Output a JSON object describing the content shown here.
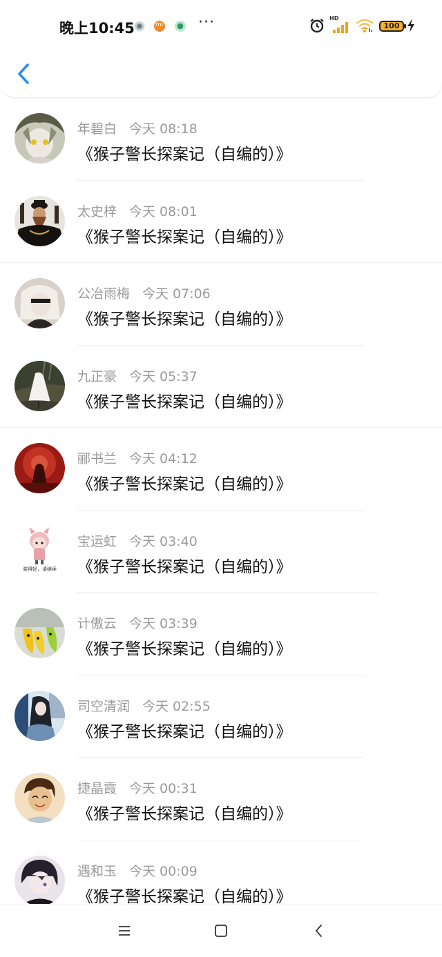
{
  "status_bar": {
    "time": "晚上10:45",
    "hd_label": "HD",
    "battery": "100",
    "icons": [
      "notification-icon",
      "mi-icon",
      "app-icon",
      "more-icon",
      "alarm-icon",
      "signal-icon",
      "wifi-icon",
      "battery-icon",
      "charging-icon"
    ]
  },
  "header": {
    "back_icon": "chevron-left-icon"
  },
  "list": {
    "items": [
      {
        "name": "年碧白",
        "time": "今天 08:18",
        "title": "《猴子警长探案记（自编的）》"
      },
      {
        "name": "太史梓",
        "time": "今天 08:01",
        "title": "《猴子警长探案记（自编的）》"
      },
      {
        "name": "公冶雨梅",
        "time": "今天 07:06",
        "title": "《猴子警长探案记（自编的）》"
      },
      {
        "name": "九正豪",
        "time": "今天 05:37",
        "title": "《猴子警长探案记（自编的）》"
      },
      {
        "name": "郦书兰",
        "time": "今天 04:12",
        "title": "《猴子警长探案记（自编的）》"
      },
      {
        "name": "宝运虹",
        "time": "今天 03:40",
        "title": "《猴子警长探案记（自编的）》",
        "avatar_caption": "装得好，请继续"
      },
      {
        "name": "计傲云",
        "time": "今天 03:39",
        "title": "《猴子警长探案记（自编的）》"
      },
      {
        "name": "司空清润",
        "time": "今天 02:55",
        "title": "《猴子警长探案记（自编的）》"
      },
      {
        "name": "捷晶霞",
        "time": "今天 00:31",
        "title": "《猴子警长探案记（自编的）》"
      },
      {
        "name": "遇和玉",
        "time": "今天 00:09",
        "title": "《猴子警长探案记（自编的）》"
      }
    ]
  },
  "nav_bar": {
    "icons": [
      "menu-icon",
      "home-icon",
      "back-icon"
    ]
  },
  "colors": {
    "accent": "#2f8ef0",
    "meta_text": "#9a9a9a",
    "signal": "#f0a31a",
    "battery": "#f2b128"
  }
}
